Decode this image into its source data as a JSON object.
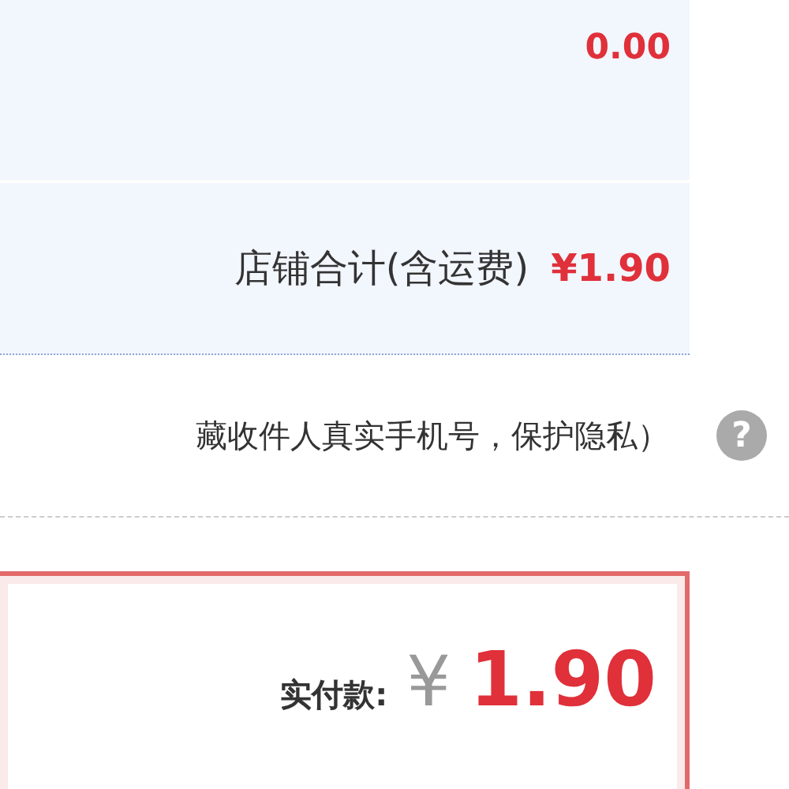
{
  "discount_row": {
    "amount": "0.00"
  },
  "shop_total": {
    "label": "店铺合计(含运费)",
    "amount": "¥1.90"
  },
  "privacy_row": {
    "text": "藏收件人真实手机号，保护隐私）",
    "help": "?"
  },
  "payment": {
    "label": "实付款:",
    "currency": "¥",
    "amount": "1.90"
  }
}
